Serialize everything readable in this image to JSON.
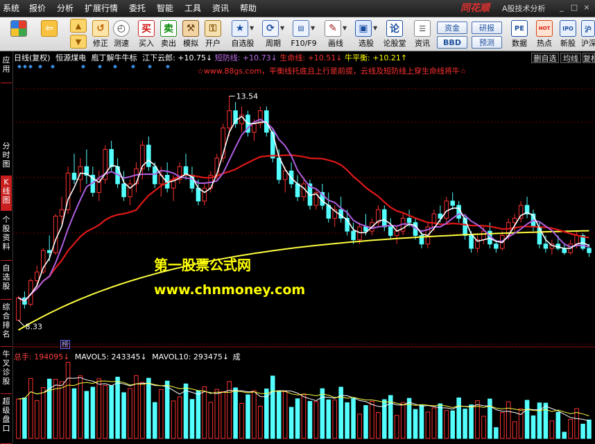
{
  "menu": [
    "系统",
    "报价",
    "分析",
    "扩展行情",
    "委托",
    "智能",
    "工具",
    "资讯",
    "帮助"
  ],
  "brand": {
    "logo": "同花顺",
    "product": "A股技术分析"
  },
  "window_controls": {
    "minimize": "_",
    "restore": "□",
    "close": "×"
  },
  "toolbar": {
    "buttons": [
      {
        "label": "",
        "icon": "windows-logo-icon"
      },
      {
        "label": "",
        "icon": "back-arrow-icon"
      },
      {
        "label": "",
        "icon": "up-arrow-icon"
      },
      {
        "label": "修正",
        "icon": "undo-icon"
      },
      {
        "label": "测速",
        "icon": "clock-icon"
      },
      {
        "label": "买入",
        "icon": "buy-icon",
        "glyph": "买"
      },
      {
        "label": "卖出",
        "icon": "sell-icon",
        "glyph": "卖"
      },
      {
        "label": "模拟",
        "icon": "hammer-icon"
      },
      {
        "label": "开户",
        "icon": "lock-icon"
      },
      {
        "label": "自选股",
        "icon": "star-icon"
      },
      {
        "label": "周期",
        "icon": "cycle-icon"
      },
      {
        "label": "F10/F9",
        "icon": "f10-icon"
      },
      {
        "label": "画线",
        "icon": "pencil-icon"
      },
      {
        "label": "选股",
        "icon": "screen-icon"
      },
      {
        "label": "论股堂",
        "icon": "discuss-icon"
      },
      {
        "label": "资讯",
        "icon": "news-icon"
      }
    ],
    "boxes": [
      "资金",
      "BBD",
      "研报",
      "预测"
    ],
    "right_buttons": [
      {
        "label": "数据",
        "icon": "pe-icon",
        "glyph": "PE"
      },
      {
        "label": "热点",
        "icon": "hot-icon",
        "glyph": "HOT"
      },
      {
        "label": "新股",
        "icon": "ipo-icon",
        "glyph": "IPO"
      },
      {
        "label": "沪深",
        "icon": "hs-icon",
        "glyph": "沪"
      }
    ]
  },
  "sidebar": {
    "tabs": [
      {
        "label": "应用",
        "active": false
      },
      {
        "label": "分时图",
        "active": false
      },
      {
        "label": "K线图",
        "active": true
      },
      {
        "label": "个股资料",
        "active": false
      },
      {
        "label": "自选股",
        "active": false
      },
      {
        "label": "综合排名",
        "active": false
      },
      {
        "label": "牛叉诊股",
        "active": false
      },
      {
        "label": "超级盘口",
        "active": false
      }
    ]
  },
  "chart_header": {
    "period": "日线(复权)",
    "stock_name": "恒源煤电",
    "indicator_name": "庖丁解牛牛标",
    "jiangxia": "江下云郎: +10.75↓",
    "duanfang": "短防线: +10.73↓",
    "shengming": "生命线: +10.51↓",
    "niupingheng": "牛平衡: +10.21↑",
    "colors": {
      "jiangxia": "#ffffff",
      "duanfang": "#c06ee8",
      "shengming": "#ff3030",
      "niupingheng": "#ffff00"
    }
  },
  "header_buttons": [
    "删自选",
    "均线",
    "复权"
  ],
  "formula_text": "☆www.88gs.com，平衡线托底且上行是前提，云线及短防线上穿生命线将牛☆",
  "price_labels": {
    "high": "13.54",
    "low": "8.33"
  },
  "watermark": {
    "title": "第一股票公式网",
    "url": "www.chnmoney.com"
  },
  "volume": {
    "total_label": "总手: 194095↓",
    "mavol5": "MAVOL5: 243345↓",
    "mavol10": "MAVOL10: 293475↓",
    "tail": "成",
    "badge": "榜"
  },
  "colors": {
    "up": "#ff3232",
    "down": "#54ffff",
    "ma_white": "#ffffff",
    "ma_purple": "#b060e0",
    "ma_red": "#e01818",
    "ma_yellow": "#ffff40",
    "grid": "#7a0000"
  },
  "chart_data": {
    "type": "candlestick",
    "ylim": [
      8.0,
      14.0
    ],
    "candles": [
      [
        8.33,
        8.9,
        8.33,
        8.85
      ],
      [
        8.85,
        9.0,
        8.6,
        8.7
      ],
      [
        8.7,
        9.3,
        8.65,
        9.25
      ],
      [
        9.25,
        9.6,
        9.1,
        9.45
      ],
      [
        9.45,
        10.0,
        9.4,
        9.95
      ],
      [
        9.95,
        10.3,
        9.7,
        9.9
      ],
      [
        9.9,
        10.8,
        9.85,
        10.75
      ],
      [
        10.75,
        11.2,
        10.5,
        10.9
      ],
      [
        10.9,
        11.9,
        10.8,
        11.75
      ],
      [
        11.75,
        12.2,
        11.5,
        11.6
      ],
      [
        11.6,
        12.1,
        11.3,
        11.9
      ],
      [
        11.9,
        12.3,
        11.5,
        11.7
      ],
      [
        11.7,
        11.9,
        11.2,
        11.3
      ],
      [
        11.3,
        11.8,
        11.1,
        11.6
      ],
      [
        11.6,
        12.4,
        11.5,
        12.3
      ],
      [
        12.3,
        12.5,
        11.8,
        11.9
      ],
      [
        11.9,
        12.1,
        11.4,
        11.5
      ],
      [
        11.5,
        11.8,
        11.1,
        11.2
      ],
      [
        11.2,
        11.6,
        11.0,
        11.5
      ],
      [
        11.5,
        12.0,
        11.3,
        11.85
      ],
      [
        11.85,
        12.5,
        11.6,
        12.4
      ],
      [
        12.4,
        12.6,
        11.8,
        11.9
      ],
      [
        11.9,
        12.0,
        11.4,
        11.5
      ],
      [
        11.5,
        11.9,
        11.2,
        11.7
      ],
      [
        11.7,
        12.0,
        11.3,
        11.4
      ],
      [
        11.4,
        11.7,
        11.1,
        11.6
      ],
      [
        11.6,
        12.0,
        11.5,
        11.9
      ],
      [
        11.9,
        12.2,
        11.6,
        11.7
      ],
      [
        11.7,
        11.9,
        11.3,
        11.4
      ],
      [
        11.4,
        11.6,
        11.0,
        11.1
      ],
      [
        11.1,
        11.5,
        11.0,
        11.4
      ],
      [
        11.4,
        11.8,
        11.3,
        11.7
      ],
      [
        11.7,
        12.2,
        11.6,
        12.1
      ],
      [
        12.1,
        12.9,
        12.0,
        12.8
      ],
      [
        12.8,
        13.54,
        12.6,
        13.2
      ],
      [
        13.2,
        13.4,
        12.8,
        12.9
      ],
      [
        12.9,
        13.3,
        12.7,
        13.1
      ],
      [
        13.1,
        13.2,
        12.6,
        12.7
      ],
      [
        12.7,
        13.0,
        12.5,
        12.9
      ],
      [
        12.9,
        13.3,
        12.8,
        13.2
      ],
      [
        13.2,
        13.3,
        12.6,
        12.7
      ],
      [
        12.7,
        12.8,
        12.0,
        12.1
      ],
      [
        12.1,
        12.3,
        11.5,
        11.6
      ],
      [
        11.6,
        11.9,
        11.3,
        11.8
      ],
      [
        11.8,
        12.0,
        11.4,
        11.5
      ],
      [
        11.5,
        11.7,
        11.1,
        11.2
      ],
      [
        11.2,
        11.6,
        11.1,
        11.5
      ],
      [
        11.5,
        11.6,
        10.9,
        11.0
      ],
      [
        11.0,
        11.4,
        10.9,
        11.3
      ],
      [
        11.3,
        11.5,
        10.9,
        11.0
      ],
      [
        11.0,
        11.3,
        10.6,
        10.7
      ],
      [
        10.7,
        11.0,
        10.5,
        10.9
      ],
      [
        10.9,
        11.2,
        10.6,
        10.7
      ],
      [
        10.7,
        10.9,
        10.3,
        10.4
      ],
      [
        10.4,
        10.6,
        10.1,
        10.2
      ],
      [
        10.2,
        10.6,
        10.1,
        10.5
      ],
      [
        10.5,
        10.8,
        10.3,
        10.4
      ],
      [
        10.4,
        10.7,
        10.3,
        10.6
      ],
      [
        10.6,
        11.0,
        10.5,
        10.9
      ],
      [
        10.9,
        11.0,
        10.4,
        10.5
      ],
      [
        10.5,
        10.7,
        10.2,
        10.3
      ],
      [
        10.3,
        10.5,
        10.1,
        10.4
      ],
      [
        10.4,
        10.8,
        10.3,
        10.7
      ],
      [
        10.7,
        10.9,
        10.5,
        10.6
      ],
      [
        10.6,
        10.7,
        10.2,
        10.3
      ],
      [
        10.3,
        10.4,
        10.0,
        10.1
      ],
      [
        10.1,
        10.6,
        10.0,
        10.5
      ],
      [
        10.5,
        10.9,
        10.4,
        10.8
      ],
      [
        10.8,
        11.0,
        10.6,
        10.7
      ],
      [
        10.7,
        11.2,
        10.6,
        11.1
      ],
      [
        11.1,
        11.3,
        10.9,
        11.0
      ],
      [
        11.0,
        11.1,
        10.6,
        10.7
      ],
      [
        10.7,
        10.8,
        10.2,
        10.3
      ],
      [
        10.3,
        10.4,
        9.9,
        10.0
      ],
      [
        10.0,
        10.3,
        9.9,
        10.2
      ],
      [
        10.2,
        10.5,
        10.1,
        10.4
      ],
      [
        10.4,
        10.6,
        10.0,
        10.1
      ],
      [
        10.1,
        10.2,
        9.9,
        10.0
      ],
      [
        10.0,
        10.4,
        9.95,
        10.3
      ],
      [
        10.3,
        10.7,
        10.2,
        10.6
      ],
      [
        10.6,
        10.8,
        10.4,
        10.7
      ],
      [
        10.7,
        11.1,
        10.6,
        11.0
      ],
      [
        11.0,
        11.2,
        10.7,
        10.8
      ],
      [
        10.8,
        10.9,
        10.4,
        10.5
      ],
      [
        10.5,
        10.6,
        10.0,
        10.1
      ],
      [
        10.1,
        10.3,
        9.9,
        10.0
      ],
      [
        10.0,
        10.2,
        9.85,
        10.1
      ],
      [
        10.1,
        10.3,
        9.95,
        10.0
      ],
      [
        10.0,
        10.1,
        9.85,
        9.9
      ],
      [
        9.9,
        10.2,
        9.85,
        10.1
      ],
      [
        10.1,
        10.4,
        10.0,
        10.3
      ],
      [
        10.3,
        10.35,
        9.95,
        10.0
      ],
      [
        10.0,
        10.1,
        9.8,
        9.9
      ]
    ],
    "volume_ylim": [
      0,
      320000
    ]
  }
}
